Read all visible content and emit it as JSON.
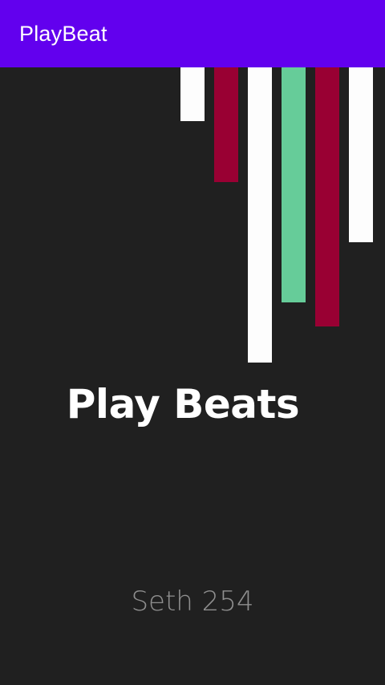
{
  "app_bar": {
    "title": "PlayBeat",
    "color": "#6200ee"
  },
  "beat_bars": [
    {
      "color": "#fdfdfd"
    },
    {
      "color": "#990033"
    },
    {
      "color": "#fdfdfd"
    },
    {
      "color": "#66cc99"
    },
    {
      "color": "#990033"
    },
    {
      "color": "#fdfdfd"
    }
  ],
  "main": {
    "headline": "Play Beats",
    "credit": "Seth 254",
    "background": "#202020"
  }
}
